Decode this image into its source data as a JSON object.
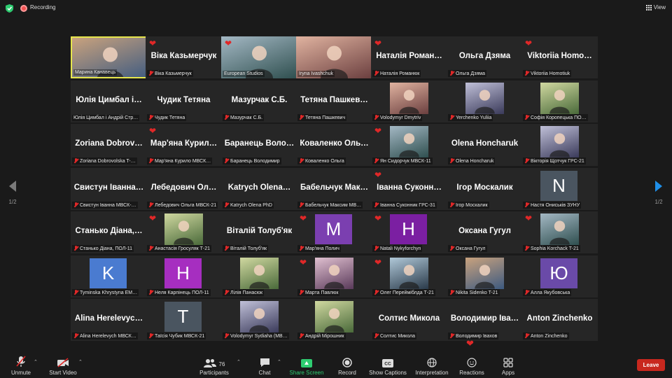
{
  "topbar": {
    "recording_label": "Recording",
    "view_label": "View"
  },
  "nav": {
    "left_page": "1/2",
    "right_page": "1/2"
  },
  "colors": {
    "active_border": "#e6e64c",
    "muted_red": "#e02828",
    "share_green": "#2ecc71",
    "leave_red": "#c8281e",
    "next_arrow": "#1f8fe8"
  },
  "tiles": [
    {
      "caption": "Марина Канавець",
      "name": "",
      "type": "video",
      "heart": false,
      "active": true,
      "muted": false
    },
    {
      "caption": "Віка Казьмерчук",
      "name": "Віка Казьмерчук",
      "type": "name",
      "heart": true,
      "muted": true
    },
    {
      "caption": "European Studios",
      "name": "",
      "type": "video",
      "heart": true,
      "muted": false
    },
    {
      "caption": "Iryna Ivashchuk",
      "name": "",
      "type": "video",
      "heart": false,
      "muted": false
    },
    {
      "caption": "Наталія Романюк",
      "name": "Наталія Роман…",
      "type": "name",
      "heart": true,
      "muted": true
    },
    {
      "caption": "Ольга Дзяма",
      "name": "Ольга Дзяма",
      "type": "name",
      "heart": false,
      "muted": true
    },
    {
      "caption": "Viktoriia Homotiuk",
      "name": "Viktoriia Homo…",
      "type": "name",
      "heart": true,
      "muted": true
    },
    {
      "caption": "Юлія Цимбал і Андрій Стр…",
      "name": "Юлія Цимбал і…",
      "type": "name",
      "heart": false,
      "muted": false
    },
    {
      "caption": "Чудик Тетяна",
      "name": "Чудик Тетяна",
      "type": "name",
      "heart": false,
      "muted": true
    },
    {
      "caption": "Мазурчак С.Б.",
      "name": "Мазурчак С.Б.",
      "type": "name",
      "heart": false,
      "muted": true
    },
    {
      "caption": "Тетяна Пашкевич",
      "name": "Тетяна Пашкев…",
      "type": "name",
      "heart": false,
      "muted": true
    },
    {
      "caption": "Volodymyr Dmytriv",
      "name": "",
      "type": "video",
      "heart": false,
      "muted": true
    },
    {
      "caption": "Yerchenko Yuliia",
      "name": "",
      "type": "video",
      "heart": false,
      "muted": true
    },
    {
      "caption": "Софія Коропецька ПО…",
      "name": "",
      "type": "video",
      "heart": false,
      "muted": true
    },
    {
      "caption": "Zoriana Dobrovolska T-…",
      "name": "Zoriana Dobrov…",
      "type": "name",
      "heart": false,
      "muted": true
    },
    {
      "caption": "Мар'яна Курило МВСК…",
      "name": "Мар'яна Курил…",
      "type": "name",
      "heart": true,
      "muted": true
    },
    {
      "caption": "Баранець Володимир",
      "name": "Баранець Воло…",
      "type": "name",
      "heart": false,
      "muted": true
    },
    {
      "caption": "Коваленко Ольга",
      "name": "Коваленко Оль…",
      "type": "name",
      "heart": false,
      "muted": true
    },
    {
      "caption": "Ян Сидорчук МВСК-11",
      "name": "",
      "type": "video",
      "heart": true,
      "muted": true
    },
    {
      "caption": "Olena Honcharuk",
      "name": "Olena Honcharuk",
      "type": "name",
      "heart": false,
      "muted": true
    },
    {
      "caption": "Вікторія Щотчук ГРС-21",
      "name": "",
      "type": "video",
      "heart": false,
      "muted": true
    },
    {
      "caption": "Свистун Іванна МВСК-…",
      "name": "Свистун Іванна…",
      "type": "name",
      "heart": false,
      "muted": true
    },
    {
      "caption": "Лебедович Ольга МВСК-21",
      "name": "Лебедович Ол…",
      "type": "name",
      "heart": false,
      "muted": true
    },
    {
      "caption": "Katrych Olena PhD",
      "name": "Katrych Olena…",
      "type": "name",
      "heart": false,
      "muted": true
    },
    {
      "caption": "Бабельчук Максим МВ…",
      "name": "Бабельчук Мак…",
      "type": "name",
      "heart": false,
      "muted": true
    },
    {
      "caption": "Іванна Суконник ГРС-31",
      "name": "Іванна Суконн…",
      "type": "name",
      "heart": true,
      "muted": true
    },
    {
      "caption": "Ігор Москалик",
      "name": "Ігор Москалик",
      "type": "name",
      "heart": false,
      "muted": true
    },
    {
      "caption": "Настя Ониськів ЗУНУ",
      "name": "",
      "type": "avatar",
      "letter": "N",
      "color": "#4a5560",
      "heart": false,
      "muted": true
    },
    {
      "caption": "Станько Діана, ПОЛ-11",
      "name": "Станько Діана,…",
      "type": "name",
      "heart": false,
      "muted": true
    },
    {
      "caption": "Анастасія Гросуляк Т-21",
      "name": "",
      "type": "video",
      "heart": true,
      "muted": true
    },
    {
      "caption": "Віталій Толуб'як",
      "name": "Віталій Толуб'як",
      "type": "name",
      "heart": false,
      "muted": true
    },
    {
      "caption": "Мар'яна Полич",
      "name": "",
      "type": "avatar",
      "letter": "M",
      "color": "#7b3fb0",
      "heart": true,
      "muted": true
    },
    {
      "caption": "Natali Nykyforchyn",
      "name": "",
      "type": "avatar",
      "letter": "H",
      "color": "#7b1fa2",
      "heart": true,
      "muted": true
    },
    {
      "caption": "Оксана Гугул",
      "name": "Оксана Гугул",
      "type": "name",
      "heart": false,
      "muted": true
    },
    {
      "caption": "Sophia Korchack T-21",
      "name": "",
      "type": "video",
      "heart": true,
      "muted": true
    },
    {
      "caption": "Tyminska Khrystyna EM…",
      "name": "",
      "type": "avatar",
      "letter": "K",
      "color": "#4a7bd0",
      "heart": false,
      "muted": true
    },
    {
      "caption": "Неля Карпінець ПОЛ-11",
      "name": "",
      "type": "avatar",
      "letter": "H",
      "color": "#a62ec0",
      "heart": false,
      "muted": true
    },
    {
      "caption": "Лілія Панасюк",
      "name": "",
      "type": "video",
      "heart": false,
      "muted": true
    },
    {
      "caption": "Марта Павлюк",
      "name": "",
      "type": "video",
      "heart": true,
      "muted": true
    },
    {
      "caption": "Олег Перейміблда Т-21",
      "name": "",
      "type": "video",
      "heart": true,
      "muted": true
    },
    {
      "caption": "Nikita Sidenko T-21",
      "name": "",
      "type": "video",
      "heart": false,
      "muted": true
    },
    {
      "caption": "Алла Якубовська",
      "name": "",
      "type": "avatar",
      "letter": "Ю",
      "color": "#6a4aa8",
      "heart": false,
      "muted": true
    },
    {
      "caption": "Alina Herelevych МВСК…",
      "name": "Alina Herelevyc…",
      "type": "name",
      "heart": false,
      "muted": true
    },
    {
      "caption": "Таїсія Чубик МВСК-21",
      "name": "",
      "type": "avatar",
      "letter": "T",
      "color": "#4a5560",
      "heart": false,
      "muted": true
    },
    {
      "caption": "Volodymyr Sydiaha (МВ…",
      "name": "",
      "type": "video",
      "heart": false,
      "muted": true
    },
    {
      "caption": "Андрій Мірошник",
      "name": "",
      "type": "video",
      "heart": false,
      "muted": true
    },
    {
      "caption": "Солтис Микола",
      "name": "Солтис Микола",
      "type": "name",
      "heart": false,
      "muted": true
    },
    {
      "caption": "Володимир Івахов",
      "name": "Володимир Іва…",
      "type": "name",
      "heart": false,
      "muted": true
    },
    {
      "caption": "Anton Zinchenko",
      "name": "Anton Zinchenko",
      "type": "name",
      "heart": false,
      "muted": true
    }
  ],
  "toolbar": {
    "unmute": "Unmute",
    "start_video": "Start Video",
    "participants": "Participants",
    "participants_count": "76",
    "chat": "Chat",
    "share_screen": "Share Screen",
    "record": "Record",
    "show_captions": "Show Captions",
    "interpretation": "Interpretation",
    "reactions": "Reactions",
    "apps": "Apps",
    "leave": "Leave"
  }
}
